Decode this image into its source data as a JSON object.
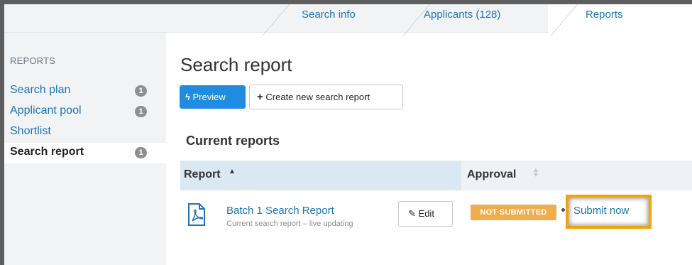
{
  "tabs": [
    {
      "label": "Search info"
    },
    {
      "label": "Applicants (128)"
    },
    {
      "label": "Reports",
      "active": true
    }
  ],
  "sidebar": {
    "heading": "REPORTS",
    "items": [
      {
        "label": "Search plan",
        "badge": "1"
      },
      {
        "label": "Applicant pool",
        "badge": "1"
      },
      {
        "label": "Shortlist",
        "badge": ""
      },
      {
        "label": "Search report",
        "badge": "1",
        "active": true
      }
    ]
  },
  "main": {
    "title": "Search report",
    "preview_label": "Preview",
    "create_label": "Create new search report",
    "section_title": "Current reports",
    "table": {
      "columns": [
        "Report",
        "Approval"
      ],
      "rows": [
        {
          "report_title": "Batch 1 Search Report",
          "report_subtitle": "Current search report – live updating",
          "edit_label": "Edit",
          "status": "NOT SUBMITTED",
          "action": "Submit now"
        }
      ]
    }
  },
  "colors": {
    "link": "#1f74b5",
    "primary": "#1f8ce0",
    "status_warning": "#f0ad4e",
    "highlight": "#f0a30a"
  }
}
